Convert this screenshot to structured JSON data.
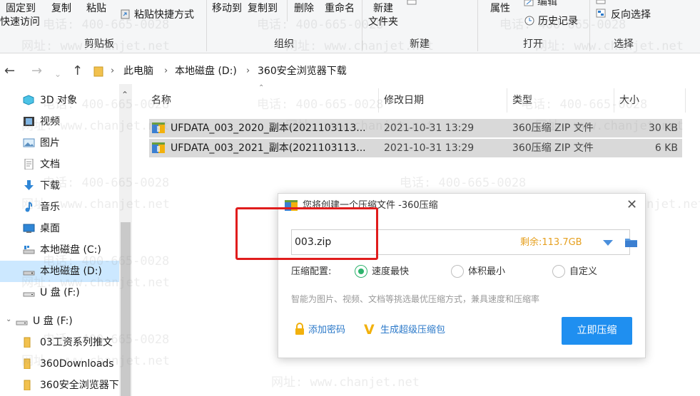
{
  "ribbon": {
    "clipboard": {
      "pin_quick_access": [
        "固定到",
        "快速访问"
      ],
      "copy": "复制",
      "paste": "粘贴",
      "paste_shortcut": "粘贴快捷方式",
      "group_label": "剪贴板"
    },
    "organize": {
      "move_to": "移动到",
      "copy_to": "复制到",
      "delete": "删除",
      "rename": "重命名",
      "group_label": "组织"
    },
    "new": {
      "new_folder": [
        "新建",
        "文件夹"
      ],
      "group_label": "新建"
    },
    "open": {
      "properties": "属性",
      "edit": "编辑",
      "history": "历史记录",
      "group_label": "打开"
    },
    "select": {
      "invert_selection": "反向选择",
      "group_label": "选择"
    }
  },
  "address": {
    "crumbs": [
      "此电脑",
      "本地磁盘 (D:)",
      "360安全浏览器下载"
    ]
  },
  "nav": {
    "items": [
      {
        "label": "3D 对象",
        "icon": "3d-objects-icon"
      },
      {
        "label": "视频",
        "icon": "video-folder-icon"
      },
      {
        "label": "图片",
        "icon": "pictures-folder-icon"
      },
      {
        "label": "文档",
        "icon": "documents-folder-icon"
      },
      {
        "label": "下载",
        "icon": "downloads-folder-icon"
      },
      {
        "label": "音乐",
        "icon": "music-folder-icon"
      },
      {
        "label": "桌面",
        "icon": "desktop-folder-icon"
      },
      {
        "label": "本地磁盘 (C:)",
        "icon": "drive-icon"
      },
      {
        "label": "本地磁盘 (D:)",
        "icon": "drive-icon",
        "selected": true
      },
      {
        "label": "U 盘 (F:)",
        "icon": "usb-drive-icon"
      },
      {
        "label": "U 盘 (F:)",
        "icon": "usb-drive-icon"
      },
      {
        "label": "03工资系列推文",
        "icon": "folder-icon"
      },
      {
        "label": "360Downloads",
        "icon": "folder-icon"
      },
      {
        "label": "360安全浏览器下",
        "icon": "folder-icon"
      }
    ]
  },
  "file_list": {
    "columns": {
      "name": "名称",
      "date": "修改日期",
      "type": "类型",
      "size": "大小"
    },
    "rows": [
      {
        "name": "UFDATA_003_2020_副本(2021103113...",
        "date": "2021-10-31 13:29",
        "type": "360压缩 ZIP 文件",
        "size": "30 KB"
      },
      {
        "name": "UFDATA_003_2021_副本(2021103113...",
        "date": "2021-10-31 13:29",
        "type": "360压缩 ZIP 文件",
        "size": "6 KB"
      }
    ]
  },
  "watermark": {
    "phone": "电话: 400-665-0028",
    "site": "网址: www.chanjet.net"
  },
  "dialog": {
    "title": "您将创建一个压缩文件 -360压缩",
    "filename": "003.zip",
    "free_space": "剩余:113.7GB",
    "config_label": "压缩配置:",
    "options": [
      {
        "label": "速度最快",
        "selected": true
      },
      {
        "label": "体积最小",
        "selected": false
      },
      {
        "label": "自定义",
        "selected": false
      }
    ],
    "hint": "智能为图片、视频、文档等挑选最优压缩方式，兼具速度和压缩率",
    "add_password": "添加密码",
    "super_compress": "生成超级压缩包",
    "compress_now": "立即压缩"
  },
  "colors": {
    "accent_blue": "#1f8ff0",
    "free_space_orange": "#e6a020",
    "radio_green": "#2db36c",
    "annotation_red": "#e01c1c"
  }
}
